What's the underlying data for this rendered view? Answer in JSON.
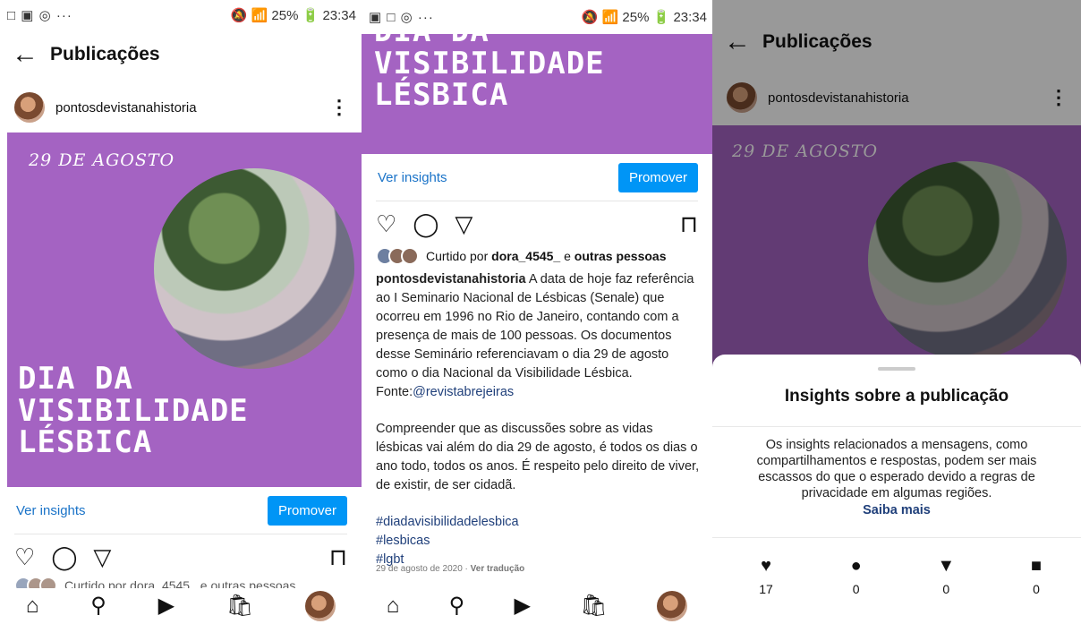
{
  "status": {
    "left_icons": "□ ▣ ◎ ···",
    "right": "🔕 📶 25% 🔋 23:34"
  },
  "status2": {
    "left_icons": "▣ □ ◎ ···",
    "right": "🔕 📶 25% 🔋 23:34"
  },
  "header": {
    "title": "Publicações",
    "back_icon": "←"
  },
  "profile": {
    "username": "pontosdevistanahistoria",
    "more_icon": "⋮"
  },
  "post": {
    "date": "29 DE AGOSTO",
    "line1": "DIA DA",
    "line2": "VISIBILIDADE",
    "line3": "LÉSBICA",
    "bg_color": "#a463c2"
  },
  "insights_link": "Ver insights",
  "promote": "Promover",
  "icons": {
    "like": "♡",
    "comment": "◯",
    "share": "▽",
    "save": "⊓"
  },
  "liked_by": {
    "prefix": "Curtido por",
    "user": "dora_4545_",
    "mid": "e",
    "rest": "outras pessoas"
  },
  "caption": {
    "user": "pontosdevistanahistoria",
    "p1": "A data de hoje faz referência ao I Seminario Nacional de Lésbicas (Senale) que ocorreu em 1996 no Rio de Janeiro, contando com a presença de mais de 100 pessoas. Os documentos desse Seminário referenciavam o dia 29 de agosto como o dia Nacional da Visibilidade Lésbica.",
    "source_prefix": "Fonte:",
    "source_handle": "@revistabrejeiras",
    "p2": "Compreender que as discussões sobre as vidas lésbicas vai além do dia 29 de agosto, é todos os dias o ano todo, todos os anos. É respeito pelo direito de viver, de existir, de ser cidadã.",
    "tag1": "#diadavisibilidadelesbica",
    "tag2": "#lesbicas",
    "tag3": "#lgbt",
    "date_line": "29 de agosto de 2020 ·",
    "translate": "Ver tradução"
  },
  "partial_liked": "Curtido por dora_4545_ e outras pessoas",
  "nav": {
    "home": "⌂",
    "search": "⚲",
    "reels": "▶",
    "shop": "🛍"
  },
  "sheet": {
    "title": "Insights sobre a publicação",
    "body": "Os insights relacionados a mensagens, como compartilhamentos e respostas, podem ser mais escassos do que o esperado devido a regras de privacidade em algumas regiões.",
    "learn_more": "Saiba mais",
    "stats": [
      {
        "icon": "♥",
        "value": "17"
      },
      {
        "icon": "●",
        "value": "0"
      },
      {
        "icon": "▼",
        "value": "0"
      },
      {
        "icon": "■",
        "value": "0"
      }
    ]
  }
}
